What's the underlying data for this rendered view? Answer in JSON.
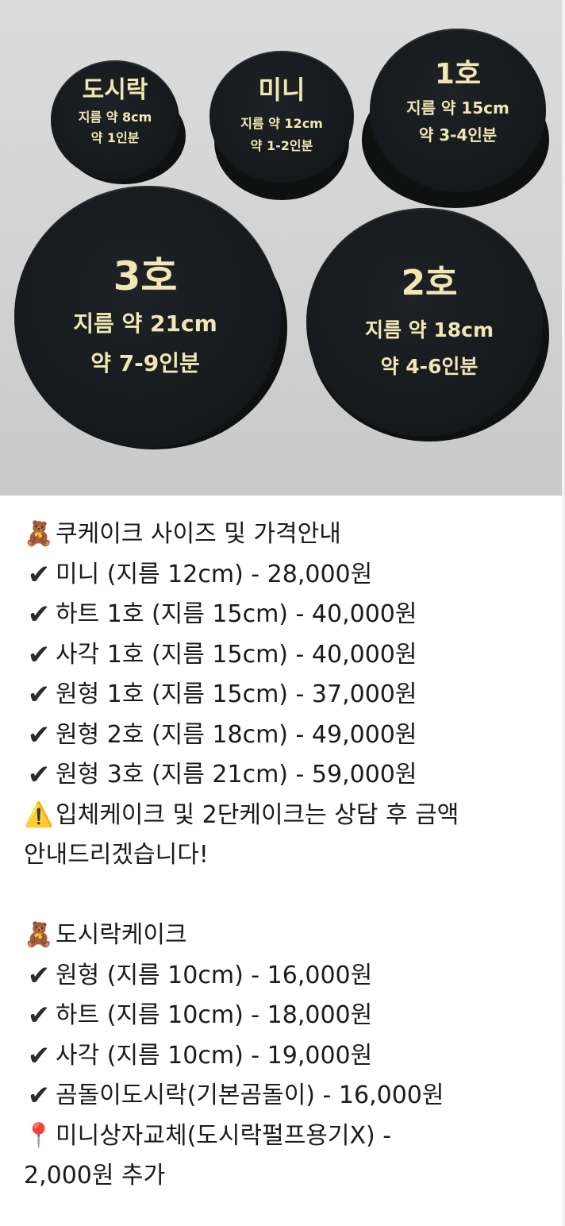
{
  "photo": {
    "tins": [
      {
        "name": "dosirak",
        "title": "도시락",
        "line1": "지름 약 8cm",
        "line2": "약 1인분"
      },
      {
        "name": "mini",
        "title": "미니",
        "line1": "지름 약 12cm",
        "line2": "약 1-2인분"
      },
      {
        "name": "no1",
        "title": "1호",
        "line1": "지름 약 15cm",
        "line2": "약 3-4인분"
      },
      {
        "name": "no3",
        "title": "3호",
        "line1": "지름 약 21cm",
        "line2": "약 7-9인분"
      },
      {
        "name": "no2",
        "title": "2호",
        "line1": "지름 약 18cm",
        "line2": "약 4-6인분"
      }
    ]
  },
  "icons": {
    "bear": "teddy-bear-icon",
    "check": "check-mark-icon",
    "warning": "warning-icon",
    "pin": "round-pushpin-icon"
  },
  "sections": {
    "cake_header": "쿠케이크 사이즈 및 가격안내",
    "cake_items": [
      "미니 (지름 12cm) - 28,000원",
      "하트 1호 (지름 15cm) - 40,000원",
      "사각 1호 (지름 15cm) - 40,000원",
      "원형 1호 (지름 15cm) - 37,000원",
      "원형 2호 (지름 18cm) - 49,000원",
      "원형 3호 (지름 21cm) - 59,000원"
    ],
    "notice_line1": "입체케이크 및 2단케이크는 상담 후 금액",
    "notice_line2": "안내드리겠습니다!",
    "dosirak_header": "도시락케이크",
    "dosirak_items": [
      "원형 (지름 10cm) - 16,000원",
      "하트 (지름 10cm) - 18,000원",
      "사각 (지름 10cm) - 19,000원",
      "곰돌이도시락(기본곰돌이) - 16,000원"
    ],
    "extra_line1": "미니상자교체(도시락펄프용기X) -",
    "extra_line2": "2,000원 추가"
  }
}
